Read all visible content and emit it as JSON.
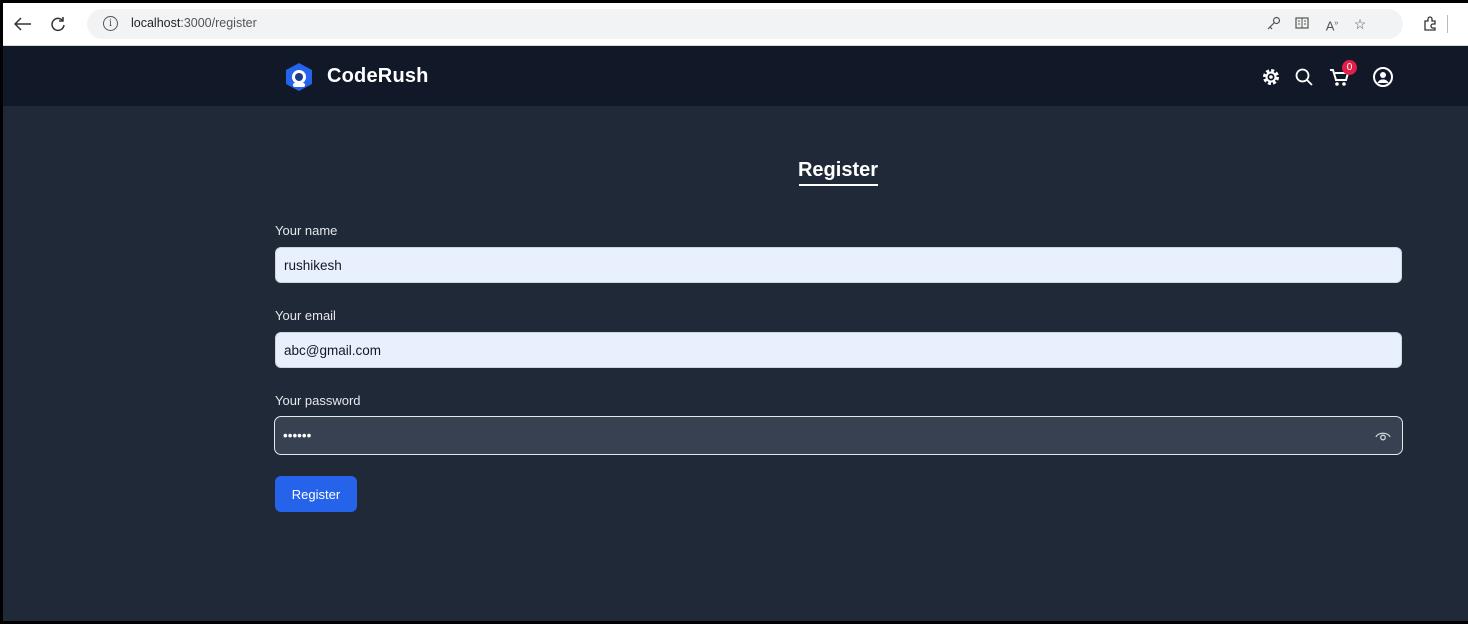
{
  "browser": {
    "url_host": "localhost",
    "url_path": ":3000/register",
    "icons": [
      "back-icon",
      "reload-icon",
      "info-icon",
      "key-icon",
      "reader-icon",
      "read-aloud-icon",
      "favorite-star-icon",
      "extensions-icon"
    ]
  },
  "navbar": {
    "brand": "CodeRush",
    "cart_count": "0",
    "icons": [
      "settings-gear-icon",
      "search-icon",
      "cart-icon",
      "user-account-icon"
    ]
  },
  "form": {
    "title": "Register",
    "name_label": "Your name",
    "name_value": "rushikesh",
    "email_label": "Your email",
    "email_value": "abc@gmail.com",
    "password_label": "Your password",
    "password_value": "••••••",
    "submit_label": "Register"
  },
  "colors": {
    "navbar_bg": "#111827",
    "page_bg": "#1f2937",
    "accent": "#2563eb",
    "badge": "#e11d48"
  }
}
